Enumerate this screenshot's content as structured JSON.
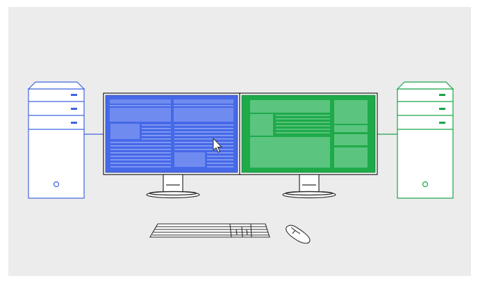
{
  "colors": {
    "background": "#ececec",
    "frame": "#ffffff",
    "left_computer": "#3f63e0",
    "left_screen_fill": "#4669e8",
    "left_screen_block": "#6f8bf0",
    "right_computer": "#19a34a",
    "right_screen_fill": "#1faa4a",
    "right_screen_block": "#5bc57f",
    "outline": "#2a2a2a",
    "peripheral_fill": "#ffffff"
  },
  "icons": {
    "left_tower": "desktop-tower-icon",
    "right_tower": "desktop-tower-icon",
    "left_monitor": "monitor-icon",
    "right_monitor": "monitor-icon",
    "keyboard": "keyboard-icon",
    "mouse": "mouse-icon",
    "cursor": "mouse-pointer-icon"
  }
}
